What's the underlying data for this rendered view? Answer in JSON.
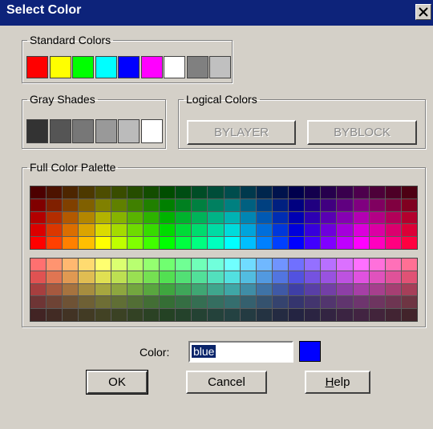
{
  "window": {
    "title": "Select Color"
  },
  "standard_colors": {
    "label": "Standard Colors",
    "swatches": [
      "#ff0000",
      "#ffff00",
      "#00ff00",
      "#00ffff",
      "#0000ff",
      "#ff00ff",
      "#ffffff",
      "#808080",
      "#c0c0c0"
    ]
  },
  "gray_shades": {
    "label": "Gray Shades",
    "swatches": [
      "#333333",
      "#555555",
      "#777777",
      "#999999",
      "#bbbbbb",
      "#ffffff"
    ]
  },
  "logical_colors": {
    "label": "Logical Colors",
    "bylayer": "BYLAYER",
    "byblock": "BYBLOCK"
  },
  "palette": {
    "label": "Full Color Palette",
    "hues": [
      0,
      15,
      30,
      45,
      60,
      75,
      90,
      105,
      120,
      135,
      150,
      165,
      180,
      195,
      210,
      225,
      240,
      255,
      270,
      285,
      300,
      315,
      330,
      345
    ]
  },
  "color_field": {
    "label": "Color:",
    "value": "blue",
    "preview": "#0000ff"
  },
  "buttons": {
    "ok": "OK",
    "cancel": "Cancel",
    "help_pre": "",
    "help_u": "H",
    "help_post": "elp"
  }
}
